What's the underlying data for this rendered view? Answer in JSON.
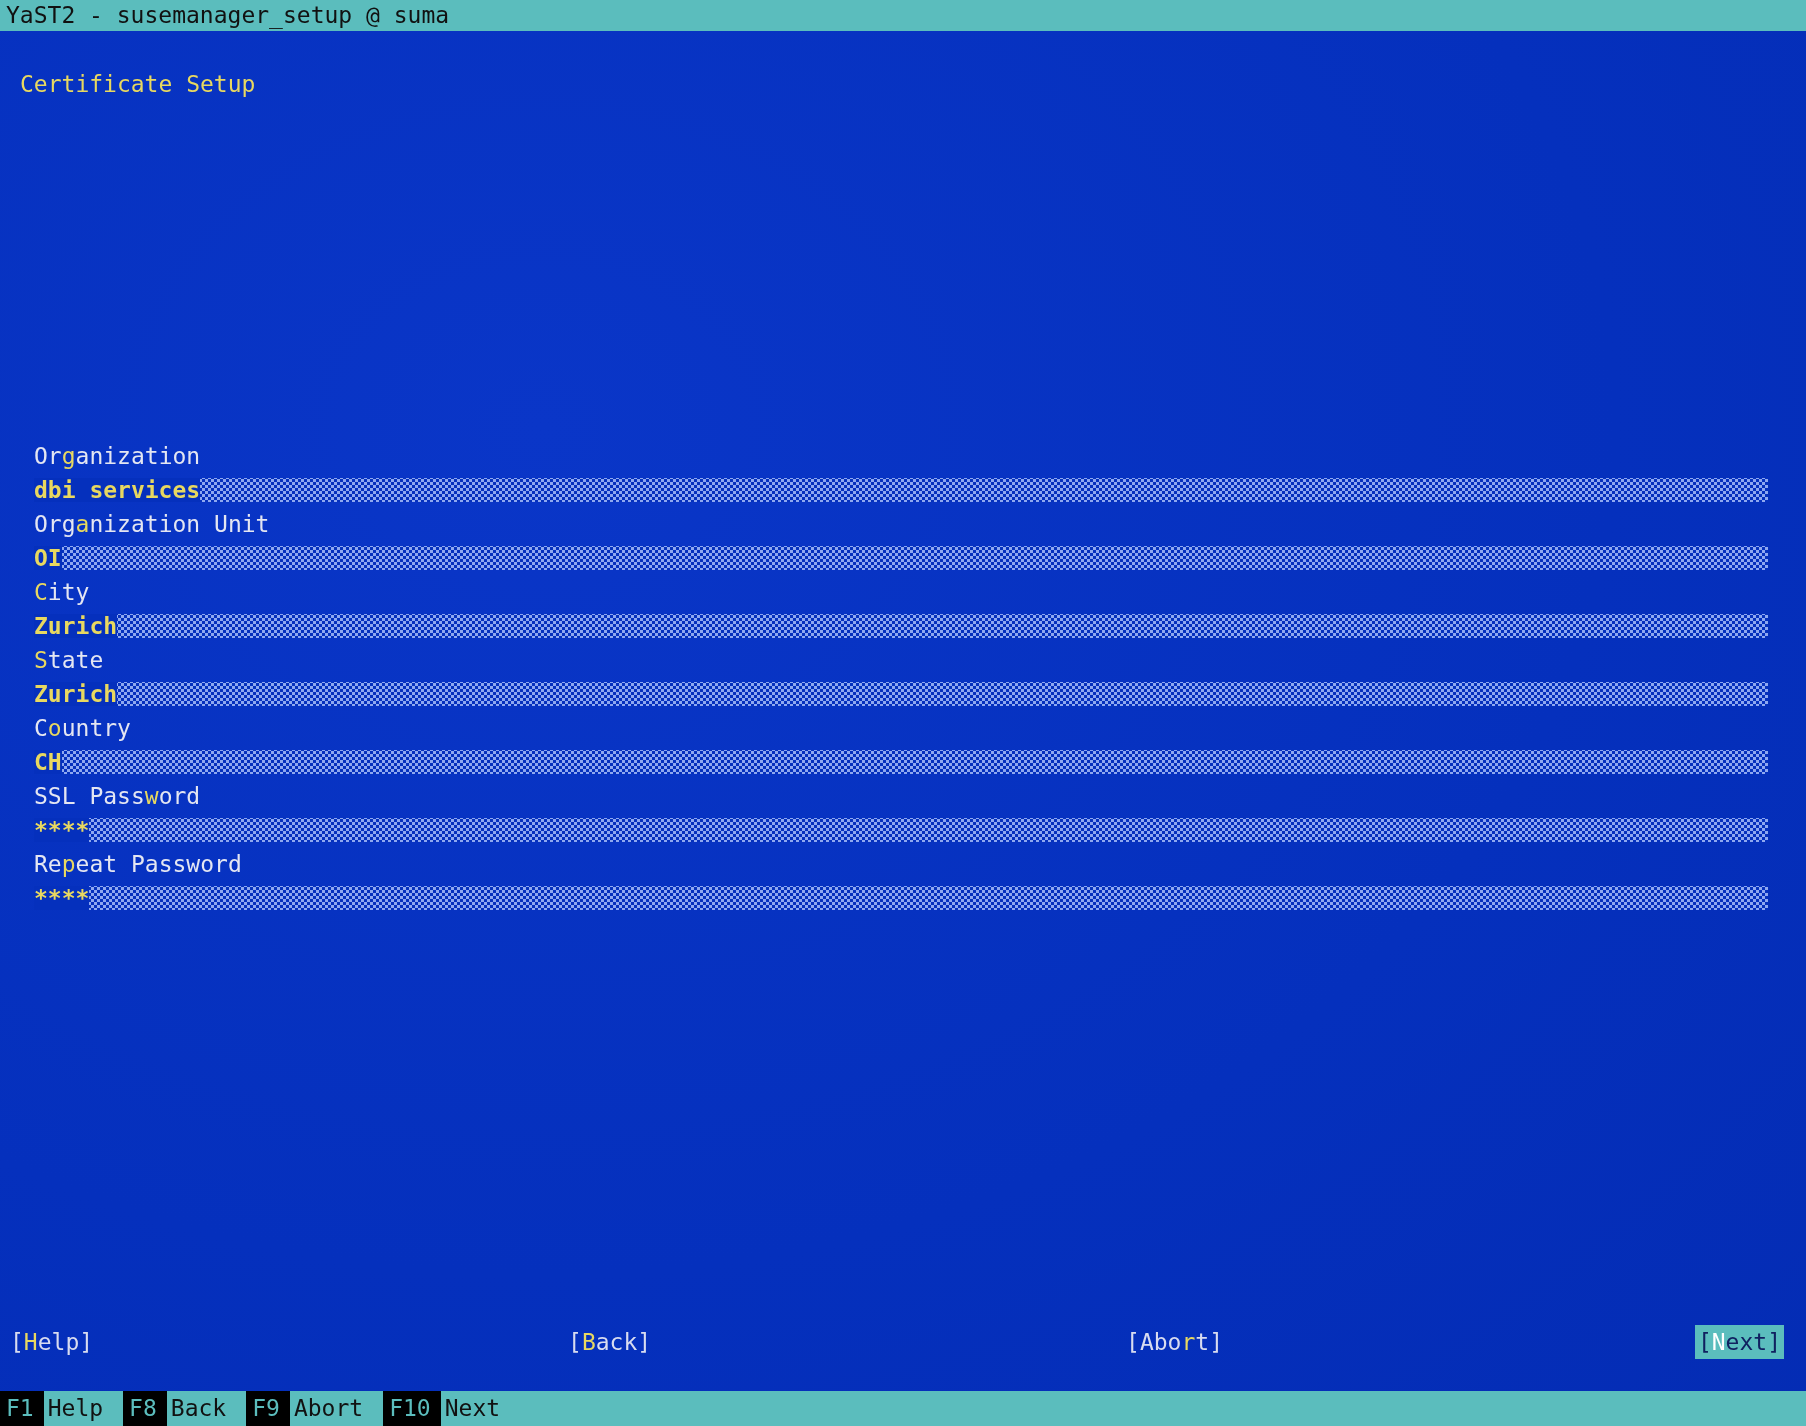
{
  "window": {
    "title": "YaST2 - susemanager_setup @ suma"
  },
  "heading": "Certificate Setup",
  "fields": [
    {
      "label": {
        "before": "Or",
        "hotkey": "g",
        "after": "anization"
      },
      "value": "dbi services"
    },
    {
      "label": {
        "before": "Org",
        "hotkey": "a",
        "after": "nization Unit"
      },
      "value": "OI"
    },
    {
      "label": {
        "hotkey": "C",
        "after": "ity"
      },
      "value": "Zurich"
    },
    {
      "label": {
        "hotkey": "S",
        "after": "tate"
      },
      "value": "Zurich"
    },
    {
      "label": {
        "before": "C",
        "hotkey": "o",
        "after": "untry"
      },
      "value": "CH"
    },
    {
      "label": {
        "before": "SSL Pass",
        "hotkey": "w",
        "after": "ord"
      },
      "value": "****"
    },
    {
      "label": {
        "before": "Re",
        "hotkey": "p",
        "after": "eat Password"
      },
      "value": "****"
    }
  ],
  "buttons": [
    {
      "before": "[",
      "hotkey": "H",
      "after": "elp]",
      "focused": false
    },
    {
      "before": "[",
      "hotkey": "B",
      "after": "ack]",
      "focused": false
    },
    {
      "before": "[Abo",
      "hotkey": "r",
      "after": "t]",
      "focused": false
    },
    {
      "before": "[",
      "hotkey": "N",
      "after": "ext]",
      "focused": true
    }
  ],
  "function_keys": [
    {
      "key": "F1",
      "label": "Help"
    },
    {
      "key": "F8",
      "label": "Back"
    },
    {
      "key": "F9",
      "label": "Abort"
    },
    {
      "key": "F10",
      "label": "Next"
    }
  ]
}
